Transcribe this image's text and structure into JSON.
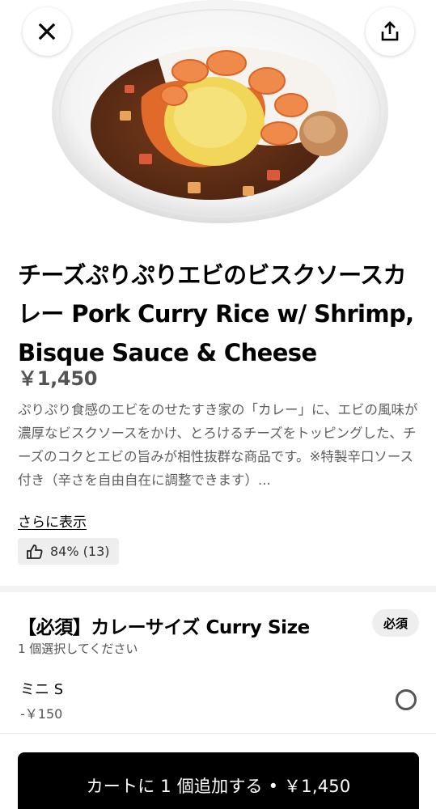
{
  "item": {
    "title": "チーズぷりぷりエビのビスクソースカレー Pork Curry Rice w/ Shrimp, Bisque Sauce & Cheese",
    "price": "￥1,450",
    "description": "ぷりぷり食感のエビをのせたすき家の「カレー」に、エビの風味が濃厚なビスクソースをかけ、とろけるチーズをトッピングした、チーズのコクとエビの旨みが相性抜群な商品です。※特製辛口ソース付き（辛さを自由自在に調整できます）...",
    "more_label": "さらに表示",
    "rating": "84% (13)"
  },
  "icons": {
    "close": "close-icon",
    "share": "share-icon",
    "like": "thumbs-up-icon"
  },
  "option_group": {
    "title": "【必須】カレーサイズ Curry Size",
    "badge": "必須",
    "subtitle": "1 個選択してください",
    "choices": [
      {
        "name": "ミニ S",
        "price_delta": "-￥150",
        "selected": false
      }
    ]
  },
  "cart": {
    "button_label": "カートに 1 個追加する • ￥1,450"
  }
}
